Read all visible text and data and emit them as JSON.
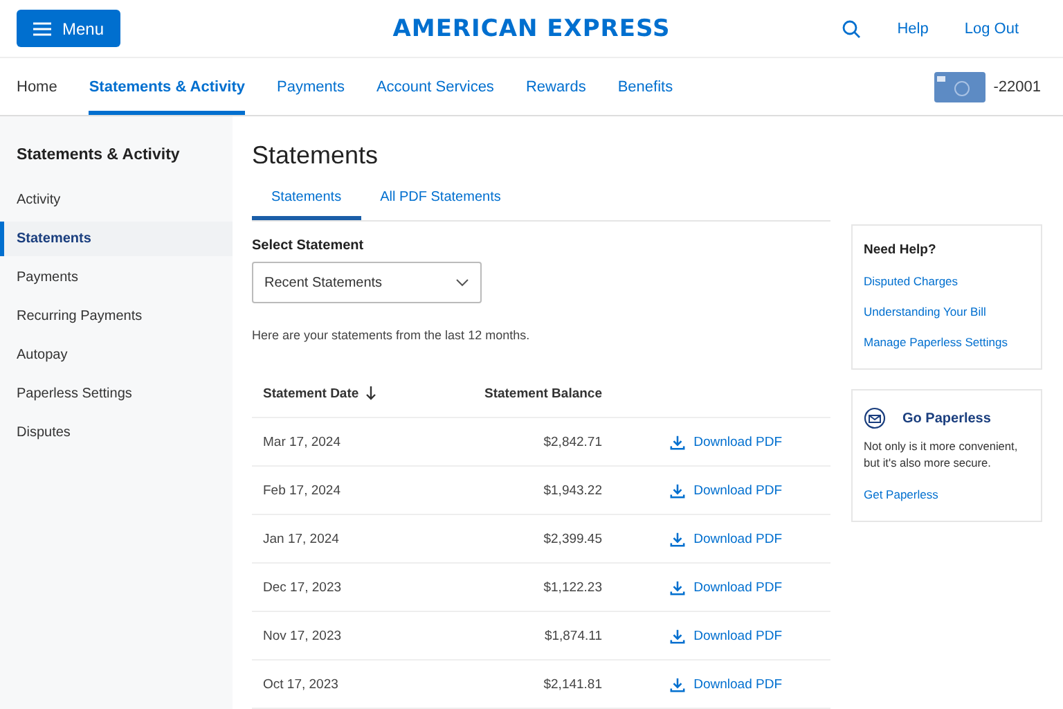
{
  "header": {
    "menu_button": "Menu",
    "logo": "AMERICAN EXPRESS",
    "links": [
      "Help",
      "Log Out"
    ]
  },
  "nav": {
    "items": [
      {
        "label": "Home",
        "selected": false
      },
      {
        "label": "Statements & Activity",
        "selected": true
      },
      {
        "label": "Payments",
        "selected": false
      },
      {
        "label": "Account Services",
        "selected": false
      },
      {
        "label": "Rewards",
        "selected": false
      },
      {
        "label": "Benefits",
        "selected": false
      }
    ],
    "card_number": "-22001"
  },
  "sidebar": {
    "title": "Statements & Activity",
    "items": [
      {
        "label": "Activity",
        "selected": false
      },
      {
        "label": "Statements",
        "selected": true
      },
      {
        "label": "Payments",
        "selected": false
      },
      {
        "label": "Recurring Payments",
        "selected": false
      },
      {
        "label": "Autopay",
        "selected": false
      },
      {
        "label": "Paperless Settings",
        "selected": false
      },
      {
        "label": "Disputes",
        "selected": false
      }
    ]
  },
  "main": {
    "title": "Statements",
    "tabs": [
      {
        "label": "Statements",
        "selected": true
      },
      {
        "label": "All PDF Statements",
        "selected": false
      }
    ],
    "select_label": "Select Statement",
    "select_value": "Recent Statements",
    "hint": "Here are your statements from the last 12 months.",
    "table": {
      "columns": [
        "Statement Date",
        "Statement Balance"
      ],
      "rows": [
        {
          "date": "Mar 17, 2024",
          "balance": "$2,842.71",
          "action": "Download PDF"
        },
        {
          "date": "Feb 17, 2024",
          "balance": "$1,943.22",
          "action": "Download PDF"
        },
        {
          "date": "Jan 17, 2024",
          "balance": "$2,399.45",
          "action": "Download PDF"
        },
        {
          "date": "Dec 17, 2023",
          "balance": "$1,122.23",
          "action": "Download PDF"
        },
        {
          "date": "Nov 17, 2023",
          "balance": "$1,874.11",
          "action": "Download PDF"
        },
        {
          "date": "Oct 17, 2023",
          "balance": "$2,141.81",
          "action": "Download PDF"
        }
      ]
    }
  },
  "help": {
    "title": "Need Help?",
    "links": [
      "Disputed Charges",
      "Understanding Your Bill",
      "Manage Paperless Settings"
    ]
  },
  "paperless": {
    "title": "Go Paperless",
    "text": "Not only is it more convenient, but it's also more secure.",
    "link": "Get Paperless"
  }
}
